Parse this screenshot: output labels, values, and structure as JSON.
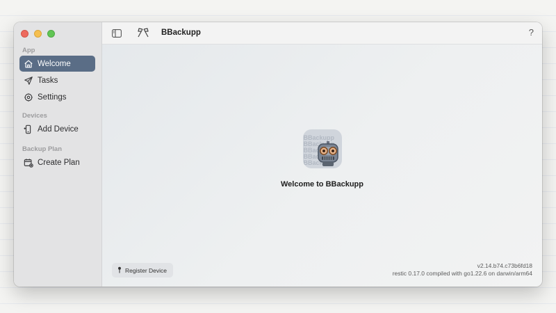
{
  "window": {
    "title": "BBackupp"
  },
  "sidebar": {
    "sections": [
      {
        "title": "App",
        "items": [
          {
            "label": "Welcome",
            "icon": "home-icon",
            "active": true
          },
          {
            "label": "Tasks",
            "icon": "paper-plane-icon",
            "active": false
          },
          {
            "label": "Settings",
            "icon": "gear-icon",
            "active": false
          }
        ]
      },
      {
        "title": "Devices",
        "items": [
          {
            "label": "Add Device",
            "icon": "phone-add-icon",
            "active": false
          }
        ]
      },
      {
        "title": "Backup Plan",
        "items": [
          {
            "label": "Create Plan",
            "icon": "calendar-add-icon",
            "active": false
          }
        ]
      }
    ]
  },
  "toolbar": {
    "help_label": "?"
  },
  "hero": {
    "title": "Welcome to BBackupp",
    "icon_watermark": [
      "BBackupp",
      "BBackupp",
      "BBackupp",
      "BBackupp",
      "BBackupp"
    ]
  },
  "footer": {
    "register_label": "Register Device",
    "version": "v2.14.b74.c73b6fd18",
    "build_info": "restic 0.17.0 compiled with go1.22.6 on darwin/arm64"
  },
  "colors": {
    "accent": "#5a6d86",
    "sidebar_bg": "#e3e3e4"
  }
}
